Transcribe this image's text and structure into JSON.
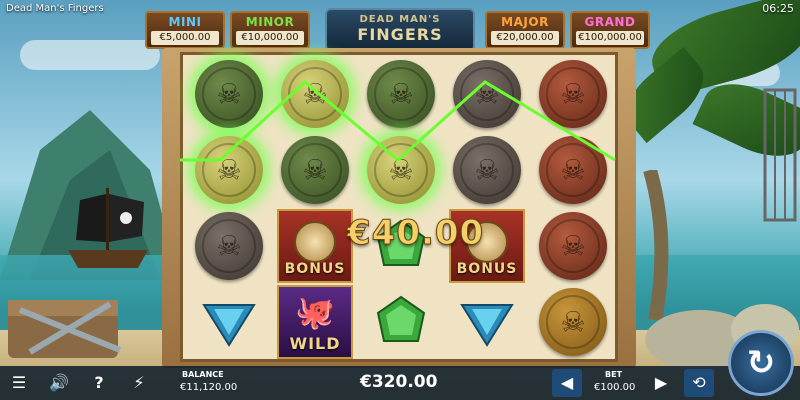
{
  "app": {
    "title": "Dead Man's Fingers",
    "clock": "06:25"
  },
  "jackpots": [
    {
      "name": "MINI",
      "value": "€5,000.00",
      "color": "#5ec8ff"
    },
    {
      "name": "MINOR",
      "value": "€10,000.00",
      "color": "#7be04a"
    },
    {
      "name": "MAJOR",
      "value": "€20,000.00",
      "color": "#ffa53a"
    },
    {
      "name": "GRAND",
      "value": "€100,000.00",
      "color": "#ff6fd6"
    }
  ],
  "logo": {
    "line1": "DEAD MAN'S",
    "line2": "FINGERS"
  },
  "reels": {
    "rows": [
      [
        "coin-green-win",
        "coin-gold-win",
        "coin-green",
        "coin-dark",
        "coin-red"
      ],
      [
        "coin-gold-win",
        "coin-green",
        "coin-gold-win",
        "coin-dark",
        "coin-red"
      ],
      [
        "coin-dark",
        "bonus",
        "gem-green",
        "bonus",
        "coin-red"
      ],
      [
        "gem-blue",
        "wild",
        "gem-green",
        "gem-blue",
        "coin-bronze"
      ]
    ],
    "bonus_label": "BONUS",
    "wild_label": "WILD"
  },
  "win_amount": "€40.00",
  "bottom_bar": {
    "balance_label": "BALANCE",
    "balance_value": "€11,120.00",
    "total_win": "€320.00",
    "bet_label": "BET",
    "bet_value": "€100.00",
    "icons": [
      "menu-icon",
      "sound-icon",
      "help-icon",
      "turbo-icon",
      "autoplay-icon",
      "spin-icon"
    ]
  },
  "colors": {
    "win_line": "#6aff2e",
    "accent_gold": "#f3d06a"
  }
}
